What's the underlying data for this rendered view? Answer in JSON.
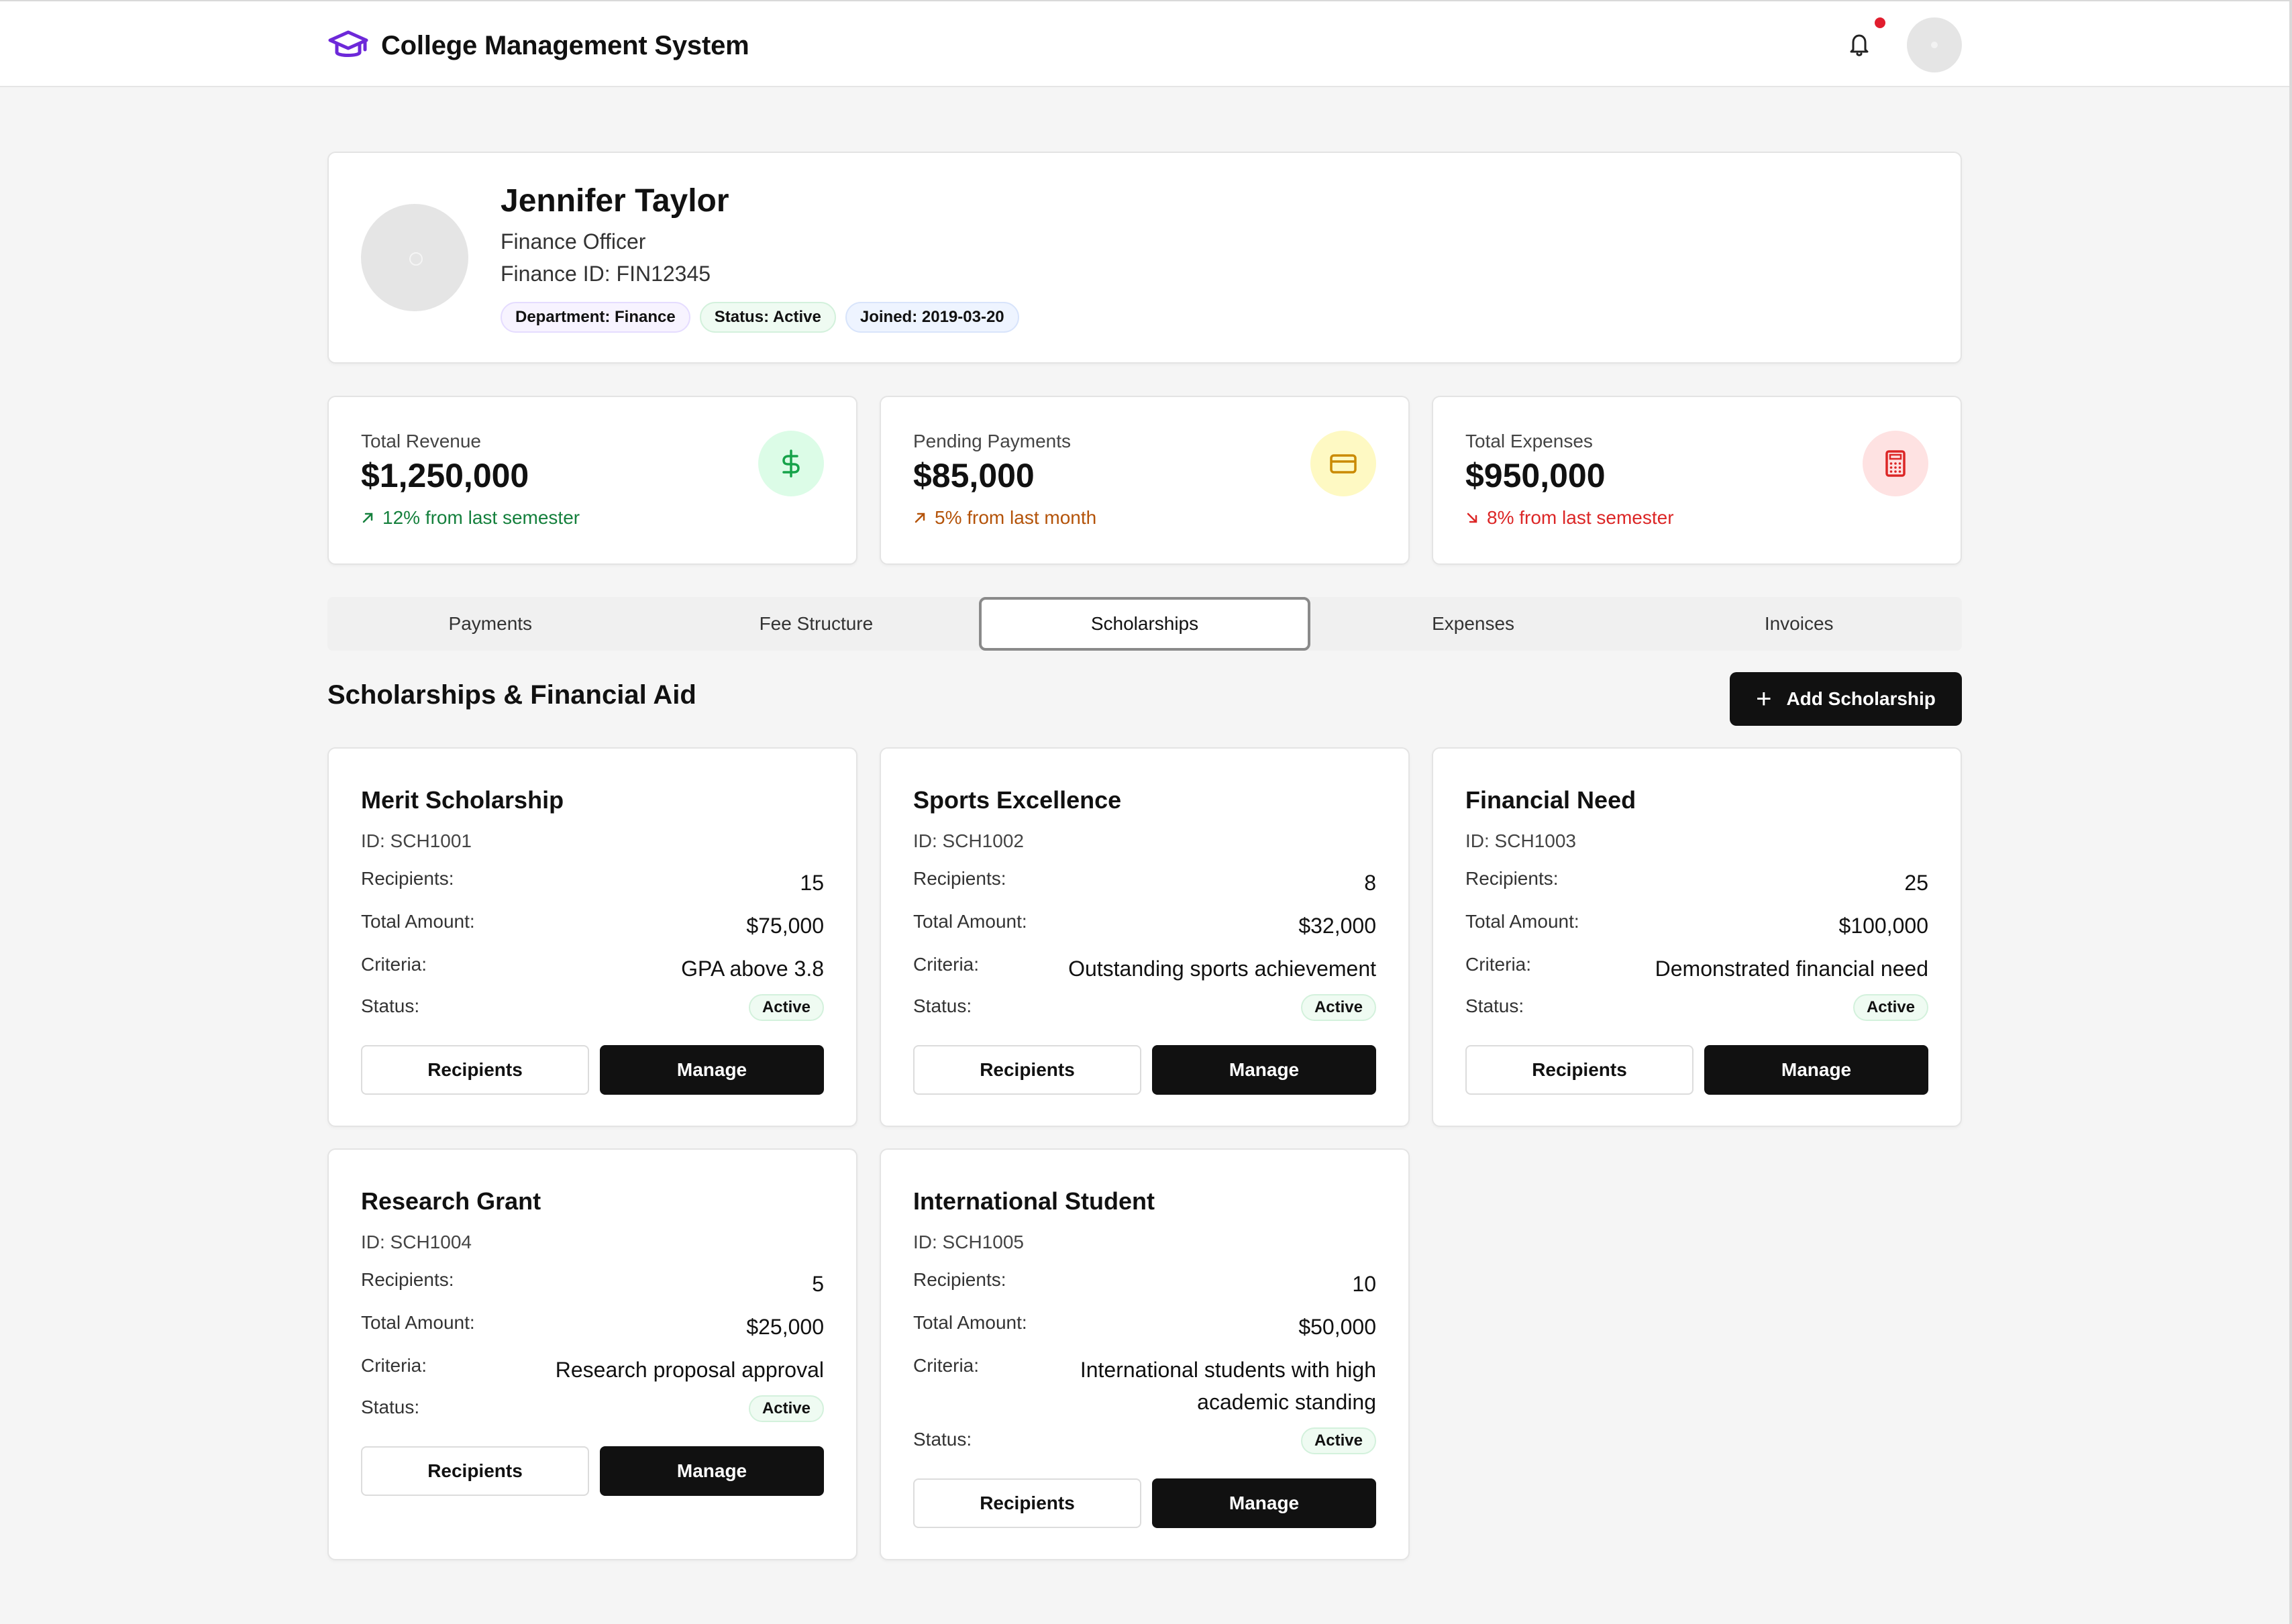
{
  "app": {
    "title": "College Management System"
  },
  "profile": {
    "name": "Jennifer Taylor",
    "role": "Finance Officer",
    "finance_id": "Finance ID: FIN12345",
    "badges": [
      "Department: Finance",
      "Status: Active",
      "Joined: 2019-03-20"
    ]
  },
  "stats": [
    {
      "label": "Total Revenue",
      "value": "$1,250,000",
      "trend": "12% from last semester",
      "trend_direction": "up",
      "trend_color": "#15803d",
      "icon": "dollar-icon",
      "icon_bg": "#dcfce7",
      "icon_color": "#16a34a"
    },
    {
      "label": "Pending Payments",
      "value": "$85,000",
      "trend": "5% from last month",
      "trend_direction": "up",
      "trend_color": "#b45309",
      "icon": "credit-card-icon",
      "icon_bg": "#fef9c3",
      "icon_color": "#ca8a04"
    },
    {
      "label": "Total Expenses",
      "value": "$950,000",
      "trend": "8% from last semester",
      "trend_direction": "down",
      "trend_color": "#dc2626",
      "icon": "calculator-icon",
      "icon_bg": "#fee2e2",
      "icon_color": "#dc2626"
    }
  ],
  "tabs": [
    {
      "label": "Payments",
      "active": false
    },
    {
      "label": "Fee Structure",
      "active": false
    },
    {
      "label": "Scholarships",
      "active": true
    },
    {
      "label": "Expenses",
      "active": false
    },
    {
      "label": "Invoices",
      "active": false
    }
  ],
  "section": {
    "title": "Scholarships & Financial Aid",
    "add_button": "Add Scholarship"
  },
  "labels": {
    "recipients": "Recipients:",
    "total_amount": "Total Amount:",
    "criteria": "Criteria:",
    "status": "Status:",
    "recipients_button": "Recipients",
    "manage_button": "Manage"
  },
  "scholarships": [
    {
      "name": "Merit Scholarship",
      "id": "ID: SCH1001",
      "recipients": "15",
      "amount": "$75,000",
      "criteria": "GPA above 3.8",
      "status": "Active"
    },
    {
      "name": "Sports Excellence",
      "id": "ID: SCH1002",
      "recipients": "8",
      "amount": "$32,000",
      "criteria": "Outstanding sports achievement",
      "status": "Active"
    },
    {
      "name": "Financial Need",
      "id": "ID: SCH1003",
      "recipients": "25",
      "amount": "$100,000",
      "criteria": "Demonstrated financial need",
      "status": "Active"
    },
    {
      "name": "Research Grant",
      "id": "ID: SCH1004",
      "recipients": "5",
      "amount": "$25,000",
      "criteria": "Research proposal approval",
      "status": "Active"
    },
    {
      "name": "International Student",
      "id": "ID: SCH1005",
      "recipients": "10",
      "amount": "$50,000",
      "criteria": "International students with high academic standing",
      "status": "Active"
    }
  ],
  "colors": {
    "brand": "#6d28d9",
    "notification_dot": "#e11d2e",
    "primary_button": "#111111"
  }
}
